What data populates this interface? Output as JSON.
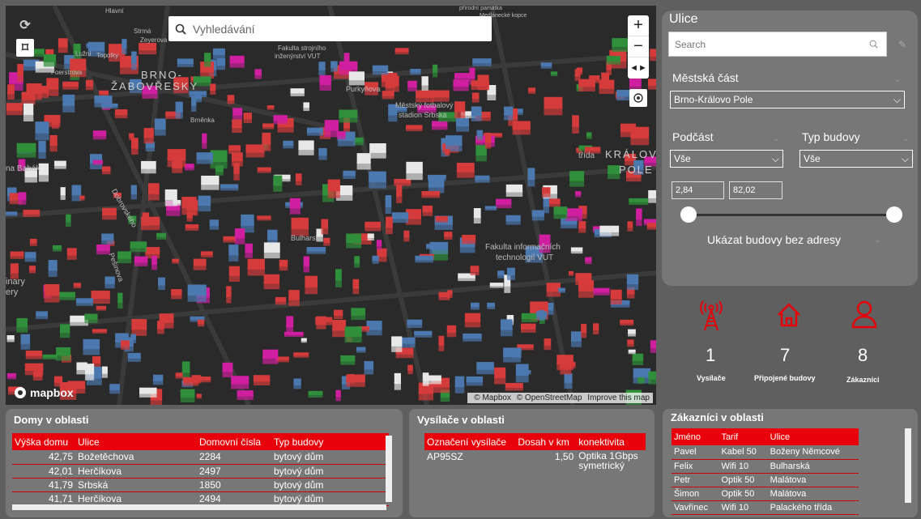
{
  "map": {
    "search_placeholder": "Vyhledávání",
    "mapbox_label": "mapbox",
    "attribution": [
      "© Mapbox",
      "© OpenStreetMap",
      "Improve this map"
    ],
    "labels": [
      {
        "text": "BRNO-"
      },
      {
        "text": "ŽABOVŘESKY"
      },
      {
        "text": "KRÁLOV"
      },
      {
        "text": "POLE"
      },
      {
        "text": "Fakulta informačních"
      },
      {
        "text": "technologií VUT"
      },
      {
        "text": "Městský fotbalový"
      },
      {
        "text": "stadion Srbská"
      },
      {
        "text": "Purkyňova"
      },
      {
        "text": "Bulharská"
      },
      {
        "text": "Pešinova"
      },
      {
        "text": "Dobrovského"
      },
      {
        "text": "na Babák"
      },
      {
        "text": "Fakulta strojního"
      },
      {
        "text": "inženýrství VUT"
      },
      {
        "text": "Foerstrova"
      },
      {
        "text": "Hlavní"
      },
      {
        "text": "Strmá"
      },
      {
        "text": "Zeyerova"
      },
      {
        "text": "Lužní"
      },
      {
        "text": "Topolky"
      },
      {
        "text": "inary"
      },
      {
        "text": "ery"
      },
      {
        "text": "Brněnka"
      },
      {
        "text": "třída"
      },
      {
        "text": "přírodní památka"
      },
      {
        "text": "Medlánecké kopce"
      }
    ],
    "building_colors": {
      "red": "#d63b3b",
      "blue": "#4c78b0",
      "green": "#2f8f3a",
      "white": "#e8e8e8",
      "magenta": "#d01ea0"
    }
  },
  "filters": {
    "title": "Ulice",
    "search_placeholder": "Search",
    "mestska_cast_label": "Městská část",
    "mestska_cast_value": "Brno-Královo Pole",
    "podcast_label": "Podčást",
    "podcast_value": "Vše",
    "typ_budovy_label": "Typ budovy",
    "typ_budovy_value": "Vše",
    "range_min": "2,84",
    "range_max": "82,02",
    "show_no_address": "Ukázat budovy bez adresy"
  },
  "stats": [
    {
      "icon": "antenna-icon",
      "value": "1",
      "label": "Vysílače"
    },
    {
      "icon": "home-icon",
      "value": "7",
      "label": "Připojené budovy"
    },
    {
      "icon": "user-icon",
      "value": "8",
      "label": "Zákazníci"
    }
  ],
  "domy": {
    "title": "Domy v oblasti",
    "columns": [
      "Výška domu",
      "Ulice",
      "Domovní čísla",
      "Typ budovy"
    ],
    "rows": [
      [
        "42,75",
        "Božetěchova",
        "2284",
        "bytový dům"
      ],
      [
        "42,01",
        "Herčíkova",
        "2497",
        "bytový dům"
      ],
      [
        "41,79",
        "Srbská",
        "1850",
        "bytový dům"
      ],
      [
        "41,71",
        "Herčíkova",
        "2494",
        "bytový dům"
      ]
    ]
  },
  "vysilace": {
    "title": "Vysílače v oblasti",
    "columns": [
      "Označení vysílače",
      "Dosah v km",
      "konektivita"
    ],
    "rows": [
      [
        "AP95SZ",
        "1,50",
        "Optika 1Gbps",
        "symetrický"
      ]
    ]
  },
  "zakaznici": {
    "title": "Zákazníci v oblasti",
    "columns": [
      "Jméno",
      "Tarif",
      "Ulice"
    ],
    "rows": [
      [
        "Pavel",
        "Kabel 50",
        "Boženy Němcové"
      ],
      [
        "Felix",
        "Wifi 10",
        "Bulharská"
      ],
      [
        "Petr",
        "Optik 50",
        "Malátova"
      ],
      [
        "Šimon",
        "Optik 50",
        "Malátova"
      ],
      [
        "Vavřinec",
        "Wifi 10",
        "Palackého třída"
      ]
    ]
  },
  "accent": "#e8000b"
}
